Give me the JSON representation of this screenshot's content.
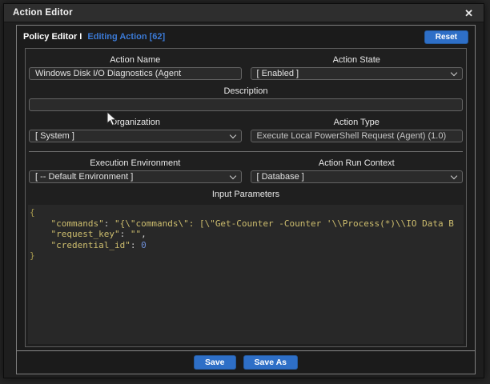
{
  "window": {
    "title": "Action Editor",
    "close_glyph": "✕"
  },
  "header": {
    "breadcrumb_primary": "Policy Editor I",
    "breadcrumb_secondary": "Editing Action [62]",
    "reset_label": "Reset"
  },
  "form": {
    "action_name": {
      "label": "Action Name",
      "value": "Windows Disk I/O Diagnostics (Agent"
    },
    "action_state": {
      "label": "Action State",
      "value": "[ Enabled ]"
    },
    "description": {
      "label": "Description",
      "value": ""
    },
    "organization": {
      "label": "Organization",
      "value": "[ System ]"
    },
    "action_type": {
      "label": "Action Type",
      "value": "Execute Local PowerShell Request (Agent) (1.0)"
    },
    "execution_environment": {
      "label": "Execution Environment",
      "value": "[ -- Default Environment ]"
    },
    "action_run_context": {
      "label": "Action Run Context",
      "value": "[ Database ]"
    },
    "input_parameters_label": "Input Parameters"
  },
  "code": {
    "lines": [
      [
        {
          "t": "{",
          "c": "brace"
        }
      ],
      [
        {
          "t": "    ",
          "c": "plain"
        },
        {
          "t": "\"commands\"",
          "c": "key"
        },
        {
          "t": ": ",
          "c": "plain"
        },
        {
          "t": "\"{\\\"commands\\\": [\\\"Get-Counter -Counter '\\\\Process(*)\\\\IO Data B",
          "c": "str"
        }
      ],
      [
        {
          "t": "    ",
          "c": "plain"
        },
        {
          "t": "\"request_key\"",
          "c": "key"
        },
        {
          "t": ": ",
          "c": "plain"
        },
        {
          "t": "\"\"",
          "c": "str"
        },
        {
          "t": ",",
          "c": "plain"
        }
      ],
      [
        {
          "t": "    ",
          "c": "plain"
        },
        {
          "t": "\"credential_id\"",
          "c": "key"
        },
        {
          "t": ": ",
          "c": "plain"
        },
        {
          "t": "0",
          "c": "num"
        }
      ],
      [
        {
          "t": "}",
          "c": "brace"
        }
      ]
    ]
  },
  "footer": {
    "save_label": "Save",
    "save_as_label": "Save As"
  },
  "colors": {
    "accent_blue": "#2e6fc7",
    "link_blue": "#3b7ad6",
    "code_key": "#cdbd6e",
    "code_number": "#6e8fd8",
    "dialog_bg": "#1e1e1e",
    "titlebar_bg": "#2e2e2e"
  }
}
